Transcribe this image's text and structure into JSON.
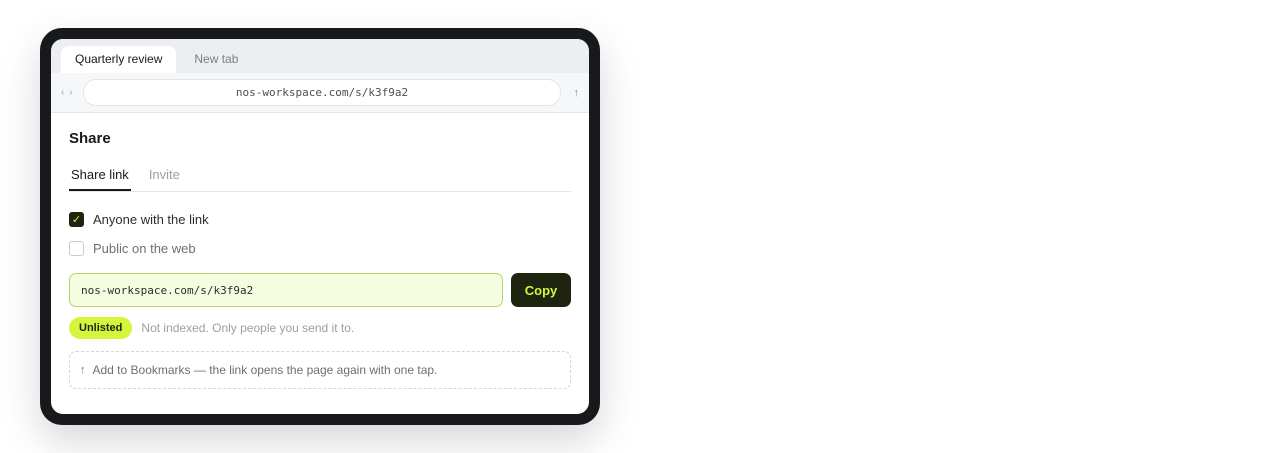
{
  "browser": {
    "tabs": [
      {
        "label": "Quarterly review",
        "active": true
      },
      {
        "label": "New tab",
        "active": false
      }
    ],
    "nav_icon": "back-forward-chevrons-icon",
    "url": "nos-workspace.com/s/k3f9a2",
    "share_icon": "share-arrow-icon",
    "share_glyph": "↑"
  },
  "share": {
    "title": "Share",
    "tabs": [
      {
        "label": "Share link",
        "active": true
      },
      {
        "label": "Invite",
        "active": false
      }
    ],
    "options": [
      {
        "label": "Anyone with the link",
        "checked": true
      },
      {
        "label": "Public on the web",
        "checked": false
      }
    ],
    "check_glyph": "✓",
    "link_value": "nos-workspace.com/s/k3f9a2",
    "copy_label": "Copy",
    "badge": "Unlisted",
    "status_text": "Not indexed. Only people you send it to.",
    "tip_glyph": "↑",
    "tip_text": "Add to Bookmarks — the link opens the page again with one tap."
  },
  "colors": {
    "accent": "#d4f53c",
    "dark": "#1e2410",
    "frame": "#17191c"
  }
}
